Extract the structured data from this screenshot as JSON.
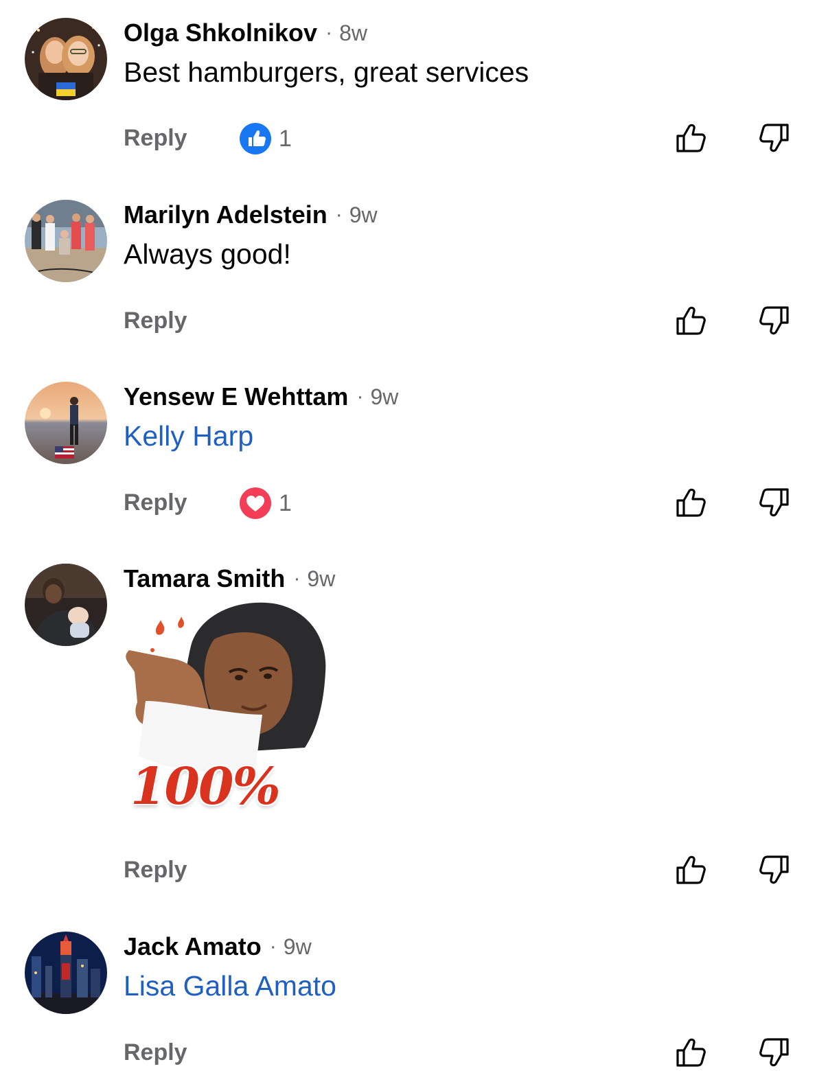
{
  "comments": [
    {
      "author": "Olga Shkolnikov",
      "time": "8w",
      "text": "Best hamburgers, great services",
      "reply_label": "Reply",
      "reaction": {
        "type": "like",
        "count": "1",
        "icon": "like-reaction-icon",
        "color": "#1877f2"
      }
    },
    {
      "author": "Marilyn Adelstein",
      "time": "9w",
      "text": "Always good!",
      "reply_label": "Reply"
    },
    {
      "author": "Yensew E Wehttam",
      "time": "9w",
      "text": "Kelly Harp",
      "text_is_mention": true,
      "reply_label": "Reply",
      "reaction": {
        "type": "love",
        "count": "1",
        "icon": "heart-reaction-icon",
        "color": "#f33e58"
      }
    },
    {
      "author": "Tamara Smith",
      "time": "9w",
      "sticker_text": "100%",
      "reply_label": "Reply"
    },
    {
      "author": "Jack Amato",
      "time": "9w",
      "text": "Lisa Galla Amato",
      "text_is_mention": true,
      "reply_label": "Reply"
    }
  ],
  "separator": "·",
  "colors": {
    "author": "#050505",
    "meta": "#65676b",
    "mention": "#1f5fc2",
    "icon_stroke": "#050505"
  }
}
